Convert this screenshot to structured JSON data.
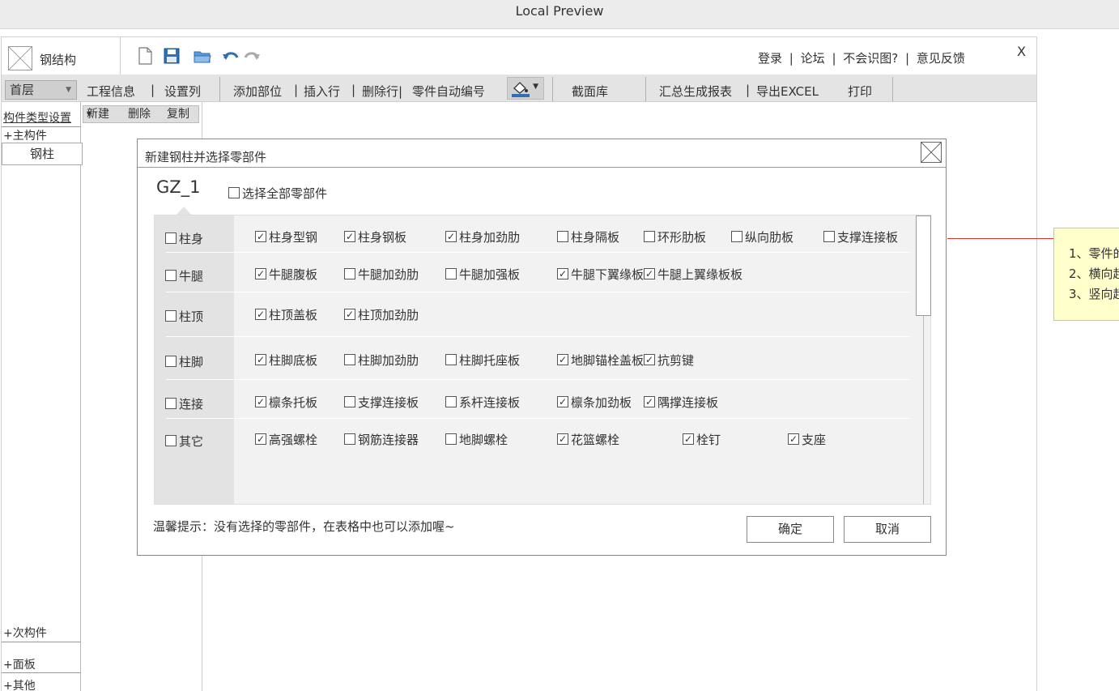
{
  "window": {
    "title": "Local Preview"
  },
  "app": {
    "name": "钢结构"
  },
  "top_links": [
    "登录",
    "|",
    "论坛",
    "|",
    "不会识图?",
    "|",
    "意见反馈"
  ],
  "close_label": "X",
  "menu": {
    "floor": "首层",
    "project_info": "工程信息",
    "sep1": "|",
    "set_columns": "设置列",
    "add_part": "添加部位",
    "sep2": "|",
    "insert_row": "插入行",
    "sep3": "|",
    "delete_row": "删除行|",
    "auto_number": "零件自动编号",
    "section_lib": "截面库",
    "report": "汇总生成报表",
    "sep4": "|",
    "export": "导出EXCEL",
    "print": "打印"
  },
  "sidebar": {
    "title": "构件类型设置",
    "main_group": "主构件",
    "active_item": "钢柱",
    "secondary_group": "次构件",
    "panel_group": "面板",
    "other_group": "其他",
    "plus": "+"
  },
  "subtoolbar": {
    "new": "新建",
    "delete": "删除",
    "copy": "复制"
  },
  "dialog": {
    "title": "新建钢柱并选择零部件",
    "column_id": "GZ_1",
    "select_all": "选择全部零部件",
    "categories": [
      {
        "name": "柱身",
        "checked": false,
        "parts": [
          {
            "label": "柱身型钢",
            "checked": true
          },
          {
            "label": "柱身钢板",
            "checked": true
          },
          {
            "label": "柱身加劲肋",
            "checked": true
          },
          {
            "label": "柱身隔板",
            "checked": false
          },
          {
            "label": "环形肋板",
            "checked": false
          },
          {
            "label": "纵向肋板",
            "checked": false
          },
          {
            "label": "支撑连接板",
            "checked": false
          }
        ]
      },
      {
        "name": "牛腿",
        "checked": false,
        "parts": [
          {
            "label": "牛腿腹板",
            "checked": true
          },
          {
            "label": "牛腿加劲肋",
            "checked": false
          },
          {
            "label": "牛腿加强板",
            "checked": false
          },
          {
            "label": "牛腿下翼缘板",
            "checked": true
          },
          {
            "label": "牛腿上翼缘板板",
            "checked": true
          }
        ]
      },
      {
        "name": "柱顶",
        "checked": false,
        "parts": [
          {
            "label": "柱顶盖板",
            "checked": true
          },
          {
            "label": "柱顶加劲肋",
            "checked": true
          }
        ]
      },
      {
        "name": "柱脚",
        "checked": false,
        "parts": [
          {
            "label": "柱脚底板",
            "checked": true
          },
          {
            "label": "柱脚加劲肋",
            "checked": false
          },
          {
            "label": "柱脚托座板",
            "checked": false
          },
          {
            "label": "地脚锚栓盖板",
            "checked": true
          },
          {
            "label": "抗剪键",
            "checked": true
          }
        ]
      },
      {
        "name": "连接",
        "checked": false,
        "parts": [
          {
            "label": "檩条托板",
            "checked": true
          },
          {
            "label": "支撑连接板",
            "checked": false
          },
          {
            "label": "系杆连接板",
            "checked": false
          },
          {
            "label": "檩条加劲板",
            "checked": true
          },
          {
            "label": "隅撑连接板",
            "checked": true
          }
        ]
      },
      {
        "name": "其它",
        "checked": false,
        "parts": [
          {
            "label": "高强螺栓",
            "checked": true
          },
          {
            "label": "钢筋连接器",
            "checked": false
          },
          {
            "label": "地脚螺栓",
            "checked": false
          },
          {
            "label": "花篮螺栓",
            "checked": true
          },
          {
            "label": "栓钉",
            "checked": true
          },
          {
            "label": "支座",
            "checked": true
          }
        ]
      }
    ],
    "tip": "温馨提示：没有选择的零部件，在表格中也可以添加喔~",
    "ok": "确定",
    "cancel": "取消"
  },
  "note": {
    "lines": [
      "1、零件的",
      "2、横向超",
      "3、竖向超"
    ]
  },
  "colors": {
    "accent_blue": "#2f6fb5",
    "note_bg": "#ffffcc",
    "connector": "#dd3333"
  }
}
